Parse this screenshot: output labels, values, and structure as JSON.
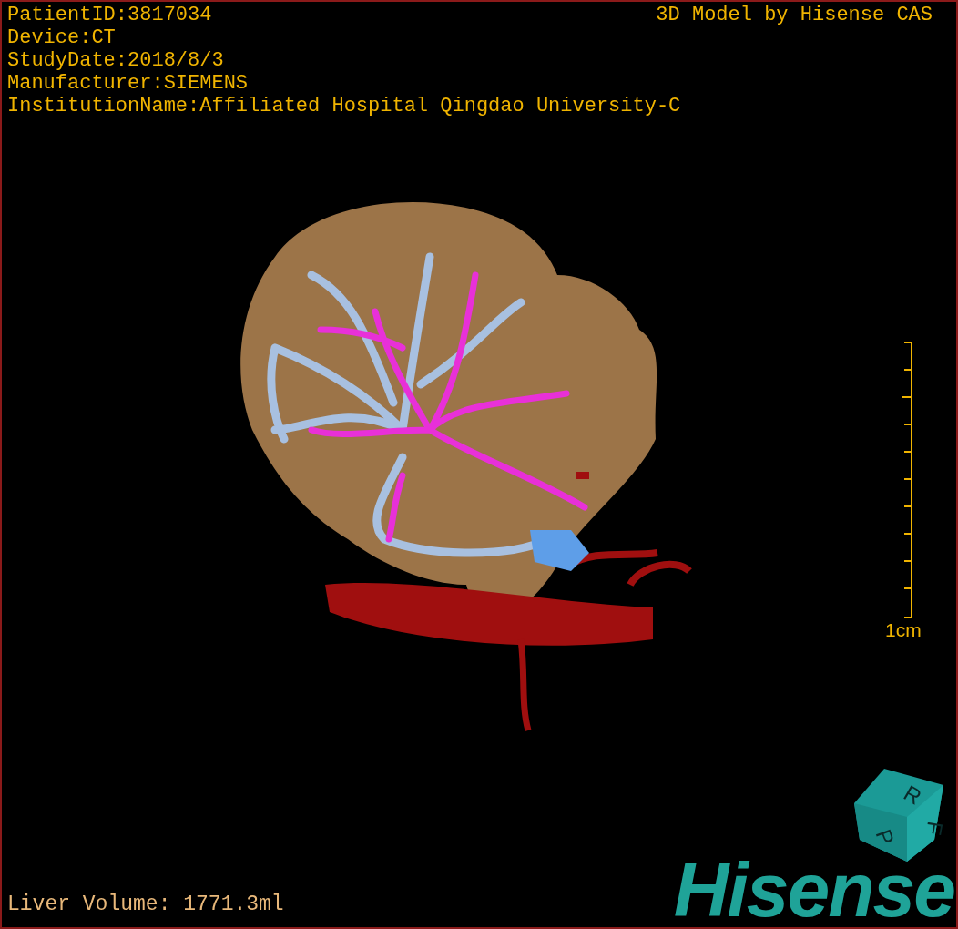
{
  "study_info": [
    "PatientID:3817034",
    "Device:CT",
    "StudyDate:2018/8/3",
    "Manufacturer:SIEMENS",
    "InstitutionName:Affiliated Hospital Qingdao University-C"
  ],
  "model_credit": "3D Model by Hisense CAS",
  "scale_bar": {
    "label": "1cm"
  },
  "orientation_cube": {
    "faces": [
      "P",
      "R",
      "F"
    ]
  },
  "liver_volume": "Liver Volume: 1771.3ml",
  "logo": "Hisense"
}
